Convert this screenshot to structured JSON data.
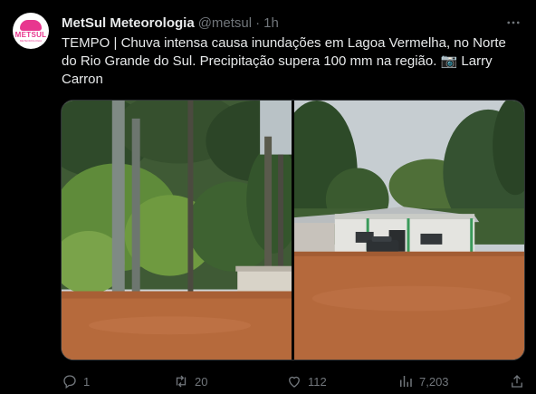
{
  "author": {
    "name": "MetSul Meteorologia",
    "handle": "@metsul",
    "separator": "·",
    "time": "1h",
    "avatar_text": "METSUL",
    "avatar_subtext": "METEOROLOGIA"
  },
  "tweet": {
    "text": "TEMPO | Chuva intensa causa inundações em Lagoa Vermelha, no Norte do Rio Grande do Sul. Precipitação supera 100 mm na região. 📷 Larry Carron"
  },
  "actions": {
    "replies": "1",
    "retweets": "20",
    "likes": "112",
    "views": "7,203"
  },
  "icons": {
    "more": "more-horizontal-icon",
    "reply": "reply-icon",
    "retweet": "retweet-icon",
    "like": "heart-icon",
    "views": "bar-chart-icon",
    "share": "share-icon"
  },
  "colors": {
    "background": "#000000",
    "text": "#e7e9ea",
    "muted": "#71767b",
    "brand": "#e8368f"
  }
}
